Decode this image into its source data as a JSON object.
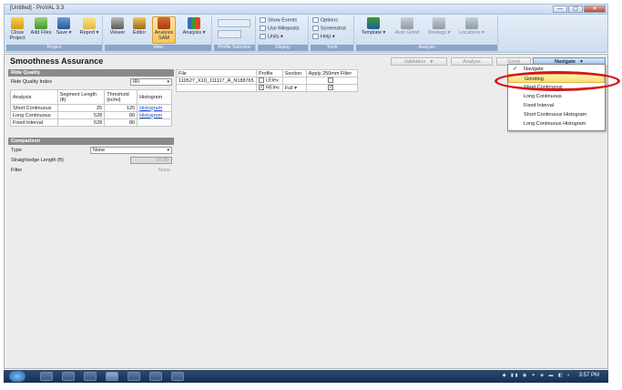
{
  "window": {
    "title": "[Untitled] - ProVAL 3.3",
    "controls": [
      "—",
      "▢",
      "✕"
    ]
  },
  "ribbon": {
    "groups": [
      {
        "label": "Project",
        "buttons": [
          "Close Project",
          "Add Files",
          "Save",
          "Report"
        ]
      },
      {
        "label": "View",
        "buttons": [
          "Viewer",
          "Editor",
          "Analysis SAM",
          "Analysis"
        ]
      },
      {
        "label": "Profile Selection",
        "buttons": []
      },
      {
        "label": "Display",
        "items": [
          "Show Events",
          "Use Mileposts",
          "Units"
        ]
      },
      {
        "label": "Tools",
        "items": [
          "Options",
          "Screenshot",
          "Help"
        ]
      },
      {
        "label": "Analysis",
        "buttons": [
          "Template",
          "Auto Grind",
          "Strategy",
          "Locations"
        ]
      }
    ]
  },
  "page": {
    "title": "Smoothness Assurance",
    "toolbar": {
      "validation": "Validation",
      "analyze": "Analyze",
      "grind": "Grind",
      "navigate": "Navigate"
    }
  },
  "ride_quality": {
    "header": "Ride Quality",
    "index_label": "Ride Quality Index",
    "index_value": "IRI",
    "columns": [
      "Analysis",
      "Segment Length (ft)",
      "Threshold (in/mi)",
      "Histogram"
    ],
    "rows": [
      {
        "analysis": "Short Continuous",
        "segment": "25",
        "threshold": "125",
        "histogram": "Histogram"
      },
      {
        "analysis": "Long Continuous",
        "segment": "528",
        "threshold": "80",
        "histogram": "Histogram"
      },
      {
        "analysis": "Fixed Interval",
        "segment": "528",
        "threshold": "80",
        "histogram": ""
      }
    ]
  },
  "comparison": {
    "header": "Comparison",
    "type_label": "Type",
    "type_value": "None",
    "straightedge_label": "Straightedge Length (ft)",
    "straightedge_value": "10.00",
    "filter_label": "Filter",
    "filter_value": "None"
  },
  "files": {
    "columns": [
      "File",
      "Profile",
      "Section",
      "Apply 250mm Filter"
    ],
    "file_name": "110527_X10_111117_A_N188765",
    "profiles": [
      {
        "name": "LElev.",
        "checked": false,
        "section": "",
        "filter": false
      },
      {
        "name": "RElev.",
        "checked": true,
        "section": "Full",
        "filter": true
      }
    ]
  },
  "navigate_menu": {
    "items": [
      {
        "label": "Navigate",
        "checked": true,
        "selected": false
      },
      {
        "label": "Grinding",
        "checked": false,
        "selected": true
      },
      {
        "label": "Short Continuous",
        "checked": false,
        "selected": false
      },
      {
        "label": "Long Continuous",
        "checked": false,
        "selected": false
      },
      {
        "label": "Fixed Interval",
        "checked": false,
        "selected": false
      },
      {
        "label": "Short Continuous Histogram",
        "checked": false,
        "selected": false
      },
      {
        "label": "Long Continuous Histogram",
        "checked": false,
        "selected": false
      }
    ]
  },
  "taskbar": {
    "clock": "3:57 PM"
  }
}
